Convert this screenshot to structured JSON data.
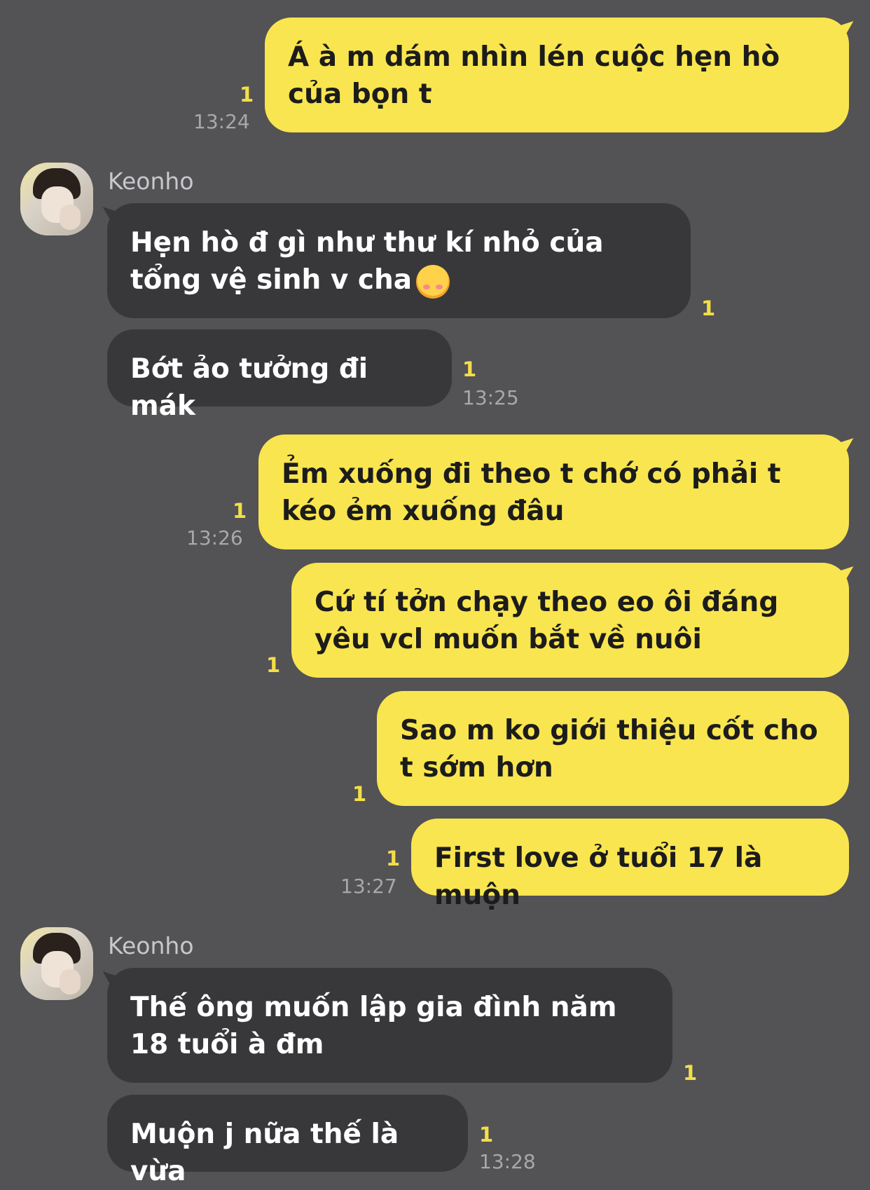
{
  "colors": {
    "background": "#535255",
    "outgoing_bubble": "#f9e54f",
    "incoming_bubble": "#38383b",
    "unread_count": "#f3de47",
    "timestamp": "#a8a7ab"
  },
  "messages": [
    {
      "side": "me",
      "text": "Á à m dám nhìn lén cuộc hẹn hò của bọn t",
      "unread": "1",
      "time": "13:24"
    },
    {
      "side": "them",
      "sender": "Keonho",
      "text": "Hẹn hò đ gì như thư kí nhỏ của tổng vệ sinh v cha",
      "emoji": "smiling-face-with-hearts-icon",
      "unread": "1",
      "time": ""
    },
    {
      "side": "them",
      "text": "Bớt ảo tưởng đi mák",
      "unread": "1",
      "time": "13:25"
    },
    {
      "side": "me",
      "text": "Ẻm xuống đi theo t chớ có phải t kéo ẻm xuống đâu",
      "unread": "1",
      "time": "13:26"
    },
    {
      "side": "me",
      "text": "Cứ tí tởn chạy theo eo ôi đáng yêu vcl muốn bắt về nuôi",
      "unread": "1",
      "time": ""
    },
    {
      "side": "me",
      "text": "Sao m ko giới thiệu cốt cho t sớm hơn",
      "unread": "1",
      "time": ""
    },
    {
      "side": "me",
      "text": "First love ở tuổi 17 là muộn",
      "unread": "1",
      "time": "13:27"
    },
    {
      "side": "them",
      "sender": "Keonho",
      "text": "Thế ông muốn lập gia đình năm 18 tuổi à đm",
      "unread": "1",
      "time": ""
    },
    {
      "side": "them",
      "text": "Muộn j nữa thế là vừa",
      "unread": "1",
      "time": "13:28"
    }
  ]
}
